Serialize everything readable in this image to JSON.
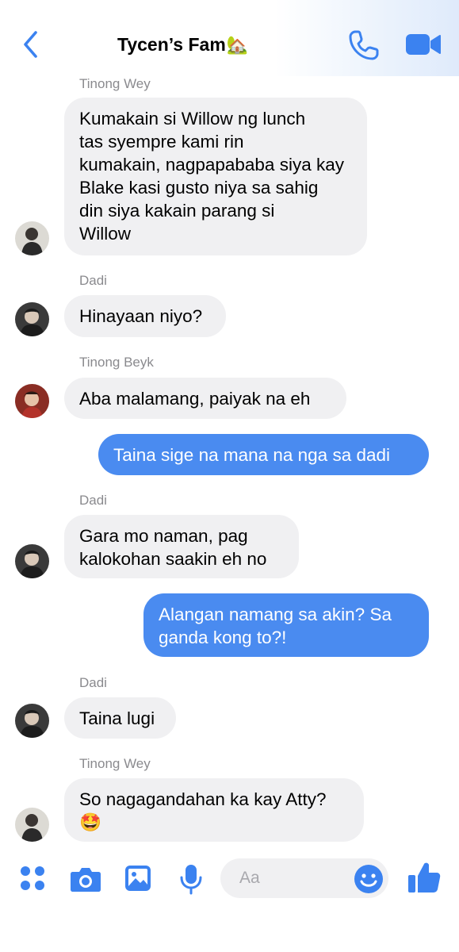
{
  "header": {
    "title": "Tycen’s Fam",
    "title_emoji": "🏡",
    "back_icon": "chevron-left-icon",
    "call_icon": "phone-icon",
    "video_icon": "video-camera-icon",
    "accent_color": "#4a8bf0"
  },
  "messages": [
    {
      "sender": "Tinong Wey",
      "direction": "incoming",
      "lines": [
        "Kumakain si Willow ng lunch",
        "tas syempre kami rin",
        "kumakain, nagpapababa siya kay",
        "Blake kasi gusto niya sa sahig",
        "din siya kakain parang si",
        "Willow"
      ]
    },
    {
      "sender": "Dadi",
      "direction": "incoming",
      "lines": [
        "Hinayaan niyo?"
      ]
    },
    {
      "sender": "Tinong Beyk",
      "direction": "incoming",
      "lines": [
        "Aba malamang, paiyak na eh"
      ]
    },
    {
      "sender": "",
      "direction": "outgoing",
      "lines": [
        "Taina sige na mana na nga sa dadi"
      ]
    },
    {
      "sender": "Dadi",
      "direction": "incoming",
      "lines": [
        "Gara mo naman, pag",
        "kalokohan saakin eh no"
      ]
    },
    {
      "sender": "",
      "direction": "outgoing",
      "lines": [
        "Alangan namang sa akin? Sa",
        "ganda kong to?!"
      ]
    },
    {
      "sender": "Dadi",
      "direction": "incoming",
      "lines": [
        "Taina lugi"
      ]
    },
    {
      "sender": "Tinong Wey",
      "direction": "incoming",
      "lines": [
        "So nagagandahan ka kay Atty?",
        "🤩"
      ]
    }
  ],
  "composer": {
    "placeholder": "Aa",
    "icons": [
      "apps-grid-icon",
      "camera-icon",
      "image-icon",
      "microphone-icon",
      "emoji-icon",
      "thumbs-up-icon"
    ]
  }
}
